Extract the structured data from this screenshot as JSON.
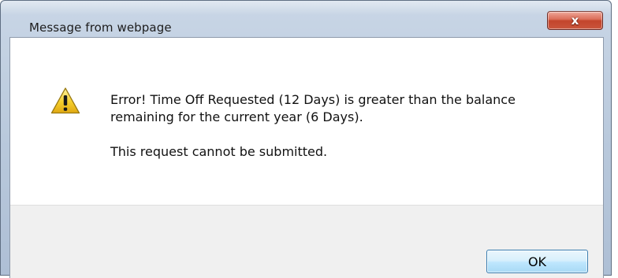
{
  "dialog": {
    "title": "Message from webpage",
    "close_glyph": "x",
    "message_line_1": "Error! Time Off Requested (12 Days) is greater than the balance",
    "message_line_2": "remaining for the current year (6 Days).",
    "message_line_3": "This request cannot be submitted.",
    "ok_label": "OK",
    "icon": "warning-icon",
    "colors": {
      "frame": "#b9c9dc",
      "close_button": "#c3452c",
      "button_area": "#f0f0f0",
      "ok_button": "#bee6fd",
      "warning_fill": "#f5c518"
    }
  }
}
